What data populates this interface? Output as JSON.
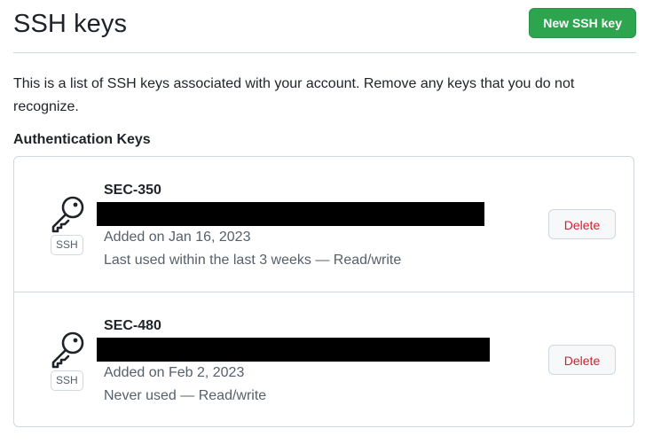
{
  "header": {
    "title": "SSH keys",
    "new_key_label": "New SSH key"
  },
  "description": "This is a list of SSH keys associated with your account. Remove any keys that you do not recognize.",
  "section_heading": "Authentication Keys",
  "keys": [
    {
      "title": "SEC-350",
      "badge": "SSH",
      "icon": "key-icon",
      "added": "Added on Jan 16, 2023",
      "usage": "Last used within the last 3 weeks — Read/write",
      "delete_label": "Delete"
    },
    {
      "title": "SEC-480",
      "badge": "SSH",
      "icon": "key-icon",
      "added": "Added on Feb 2, 2023",
      "usage": "Never used — Read/write",
      "delete_label": "Delete"
    }
  ],
  "colors": {
    "primary_button": "#2da44e",
    "danger_text": "#cf222e",
    "border": "#d0d7de",
    "muted_text": "#57606a",
    "redaction": "#000000"
  }
}
